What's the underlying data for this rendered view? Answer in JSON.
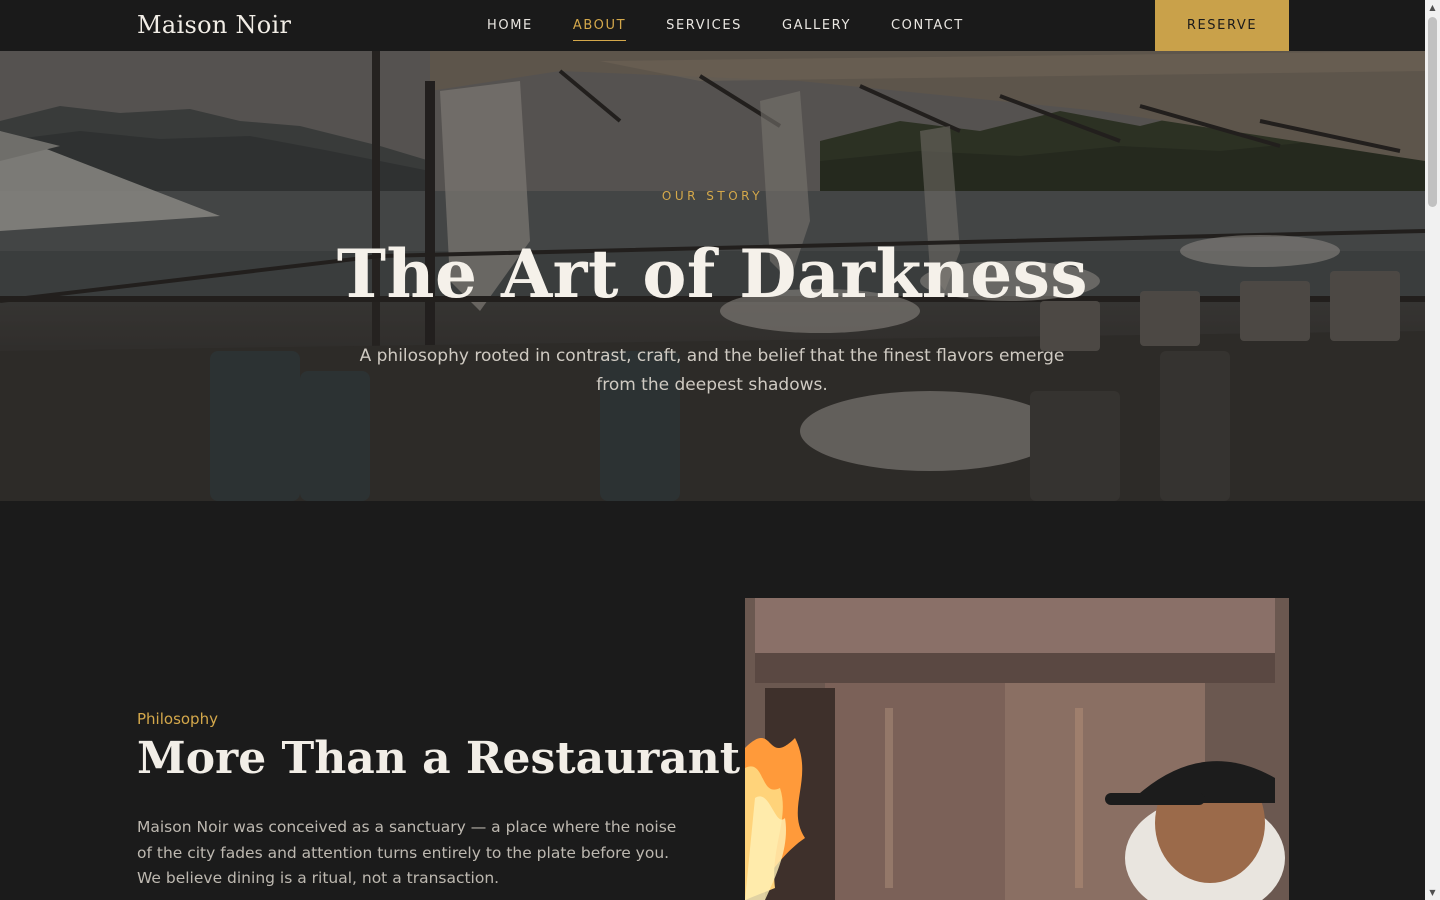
{
  "brand": "Maison Noir",
  "nav": {
    "items": [
      {
        "label": "HOME"
      },
      {
        "label": "ABOUT",
        "active": true
      },
      {
        "label": "SERVICES"
      },
      {
        "label": "GALLERY"
      },
      {
        "label": "CONTACT"
      }
    ],
    "reserve_label": "RESERVE"
  },
  "hero": {
    "eyebrow": "OUR STORY",
    "title": "The Art of Darkness",
    "subtitle": "A philosophy rooted in contrast, craft, and the belief that the finest flavors emerge from the deepest shadows."
  },
  "philosophy": {
    "eyebrow": "Philosophy",
    "title": "More Than a Restaurant",
    "body": "Maison Noir was conceived as a sanctuary — a place where the noise of the city fades and attention turns entirely to the plate before you. We believe dining is a ritual, not a transaction."
  },
  "colors": {
    "background": "#1b1b1b",
    "accent_gold": "#c9a14a",
    "text_light": "#f2eee7"
  },
  "icons": {
    "scroll_up": "triangle-up-icon",
    "scroll_down": "triangle-down-icon"
  }
}
